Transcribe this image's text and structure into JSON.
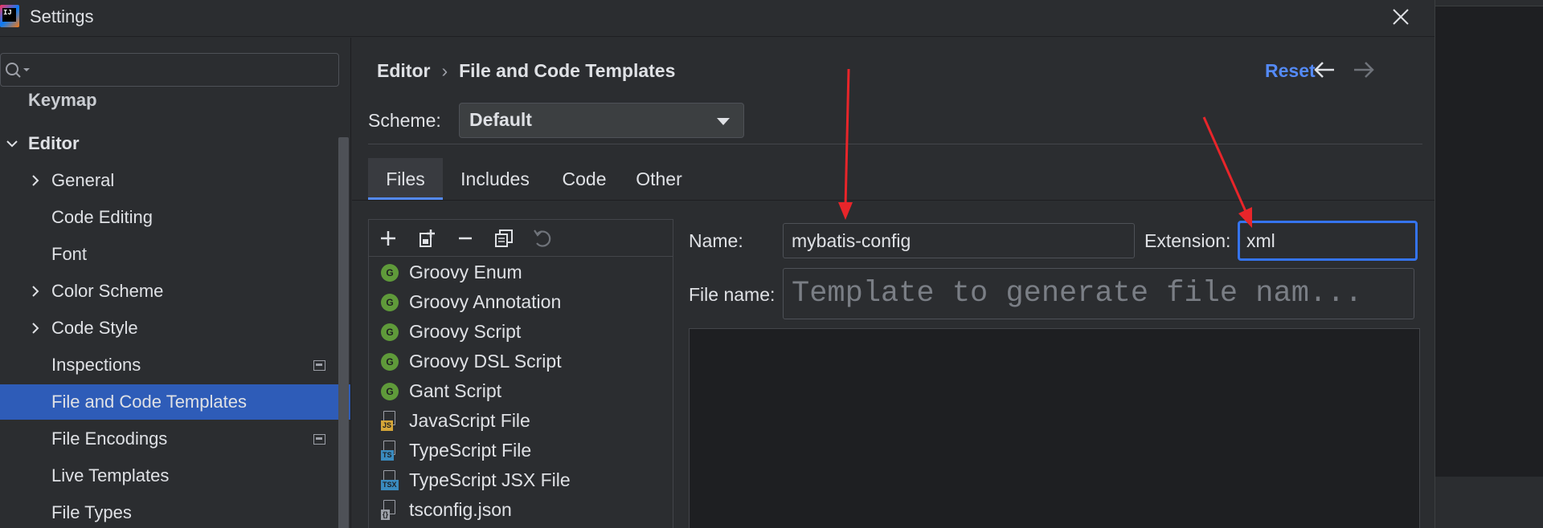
{
  "window": {
    "title": "Settings",
    "logo_text": "IJ"
  },
  "sidebar": {
    "search": {
      "placeholder": ""
    },
    "items": [
      {
        "label": "Keymap"
      },
      {
        "label": "Editor"
      },
      {
        "label": "General"
      },
      {
        "label": "Code Editing"
      },
      {
        "label": "Font"
      },
      {
        "label": "Color Scheme"
      },
      {
        "label": "Code Style"
      },
      {
        "label": "Inspections"
      },
      {
        "label": "File and Code Templates"
      },
      {
        "label": "File Encodings"
      },
      {
        "label": "Live Templates"
      },
      {
        "label": "File Types"
      }
    ]
  },
  "header": {
    "breadcrumb": [
      "Editor",
      "File and Code Templates"
    ],
    "separator": "›",
    "reset_label": "Reset"
  },
  "scheme": {
    "label": "Scheme:",
    "value": "Default"
  },
  "tabs": [
    {
      "label": "Files"
    },
    {
      "label": "Includes"
    },
    {
      "label": "Code"
    },
    {
      "label": "Other"
    }
  ],
  "templates": [
    {
      "label": "Groovy Enum",
      "icon": "G"
    },
    {
      "label": "Groovy Annotation",
      "icon": "G"
    },
    {
      "label": "Groovy Script",
      "icon": "G"
    },
    {
      "label": "Groovy DSL Script",
      "icon": "G"
    },
    {
      "label": "Gant Script",
      "icon": "G"
    },
    {
      "label": "JavaScript File",
      "icon": "JS"
    },
    {
      "label": "TypeScript File",
      "icon": "TS"
    },
    {
      "label": "TypeScript JSX File",
      "icon": "TSX"
    },
    {
      "label": "tsconfig.json",
      "icon": "{}"
    }
  ],
  "form": {
    "name_label": "Name:",
    "name_value": "mybatis-config",
    "extension_label": "Extension:",
    "extension_value": "xml",
    "file_name_label": "File name:",
    "file_name_placeholder": "Template to generate file nam..."
  },
  "colors": {
    "accent": "#548af7",
    "selection": "#2e5cb8",
    "annotation_arrow": "#e8252a",
    "groovy_icon": "#5f9a3a"
  }
}
